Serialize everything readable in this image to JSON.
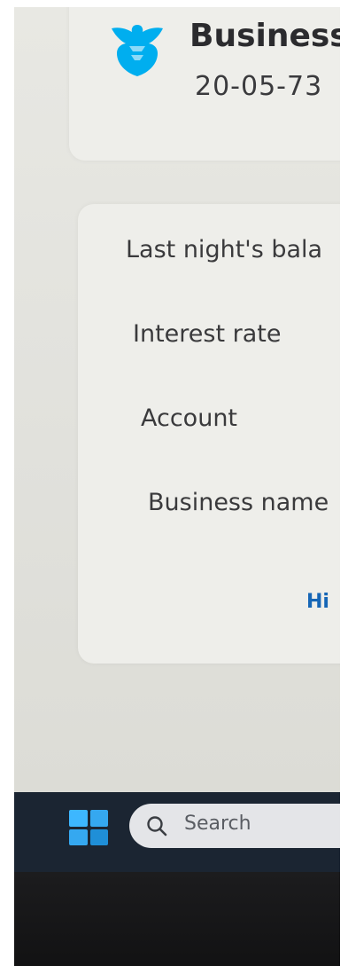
{
  "bank": {
    "logo_icon": "eagle-icon",
    "brand_color": "#00aeef",
    "account_title": "Business",
    "sort_code": "20-05-73"
  },
  "details": {
    "rows": [
      {
        "label": "Last night's bala"
      },
      {
        "label": "Interest rate"
      },
      {
        "label": "Account"
      },
      {
        "label": "Business name"
      }
    ],
    "hide_link": "Hi",
    "link_color": "#1666b6"
  },
  "taskbar": {
    "start_icon": "windows-logo-icon",
    "search_icon": "search-icon",
    "search_placeholder": "Search"
  }
}
